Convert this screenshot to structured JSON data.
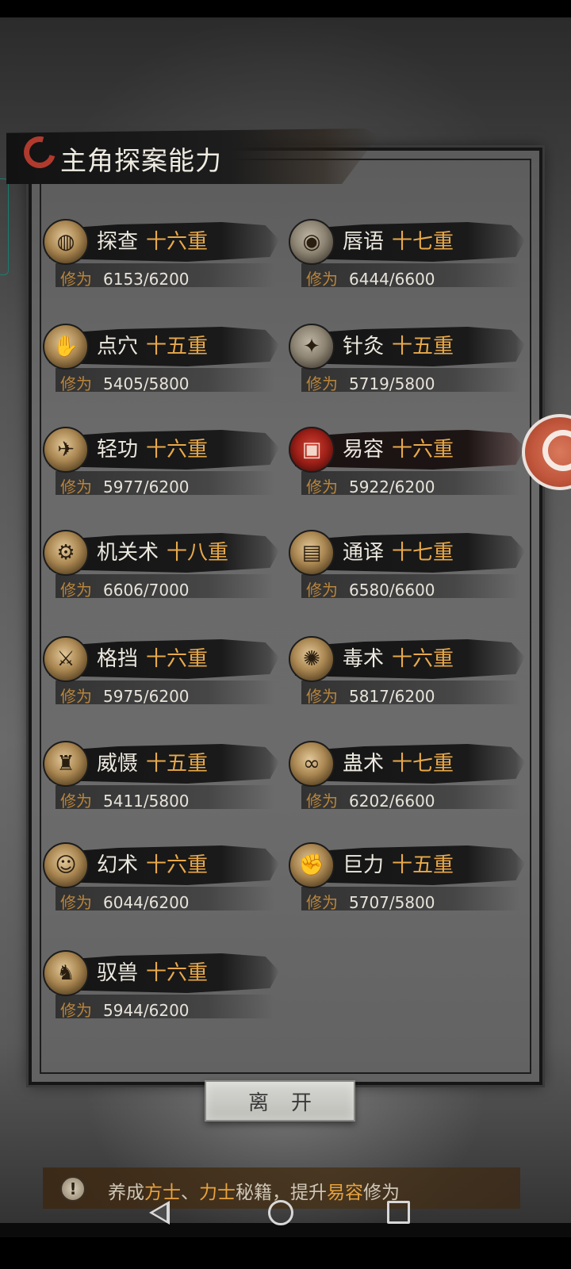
{
  "title": "主角探案能力",
  "progress_label": "修为",
  "skills": [
    {
      "name": "探查",
      "level": "十六重",
      "progress": "6153/6200",
      "icon": "investigate-icon",
      "glyph": "◍"
    },
    {
      "name": "唇语",
      "level": "十七重",
      "progress": "6444/6600",
      "icon": "lip-reading-icon",
      "glyph": "◉"
    },
    {
      "name": "点穴",
      "level": "十五重",
      "progress": "5405/5800",
      "icon": "acupoint-icon",
      "glyph": "✋"
    },
    {
      "name": "针灸",
      "level": "十五重",
      "progress": "5719/5800",
      "icon": "acupuncture-icon",
      "glyph": "✦"
    },
    {
      "name": "轻功",
      "level": "十六重",
      "progress": "5977/6200",
      "icon": "lightness-skill-icon",
      "glyph": "✈"
    },
    {
      "name": "易容",
      "level": "十六重",
      "progress": "5922/6200",
      "icon": "disguise-icon",
      "glyph": "▣"
    },
    {
      "name": "机关术",
      "level": "十八重",
      "progress": "6606/7000",
      "icon": "mechanism-gear-icon",
      "glyph": "⚙"
    },
    {
      "name": "通译",
      "level": "十七重",
      "progress": "6580/6600",
      "icon": "translation-scroll-icon",
      "glyph": "▤"
    },
    {
      "name": "格挡",
      "level": "十六重",
      "progress": "5975/6200",
      "icon": "parry-icon",
      "glyph": "⚔"
    },
    {
      "name": "毒术",
      "level": "十六重",
      "progress": "5817/6200",
      "icon": "poison-spider-icon",
      "glyph": "✺"
    },
    {
      "name": "威慑",
      "level": "十五重",
      "progress": "5411/5800",
      "icon": "intimidate-icon",
      "glyph": "♜"
    },
    {
      "name": "蛊术",
      "level": "十七重",
      "progress": "6202/6600",
      "icon": "gu-worm-icon",
      "glyph": "∞"
    },
    {
      "name": "幻术",
      "level": "十六重",
      "progress": "6044/6200",
      "icon": "illusion-icon",
      "glyph": "☺"
    },
    {
      "name": "巨力",
      "level": "十五重",
      "progress": "5707/5800",
      "icon": "strength-icon",
      "glyph": "✊"
    },
    {
      "name": "驭兽",
      "level": "十六重",
      "progress": "5944/6200",
      "icon": "beast-taming-wolf-icon",
      "glyph": "♞"
    }
  ],
  "leave_button": "离开",
  "tip": {
    "prefix": "养成",
    "hl1": "方士",
    "sep": "、",
    "hl2": "力士",
    "mid": "秘籍，提升",
    "hl3": "易容",
    "suffix": "修为"
  }
}
